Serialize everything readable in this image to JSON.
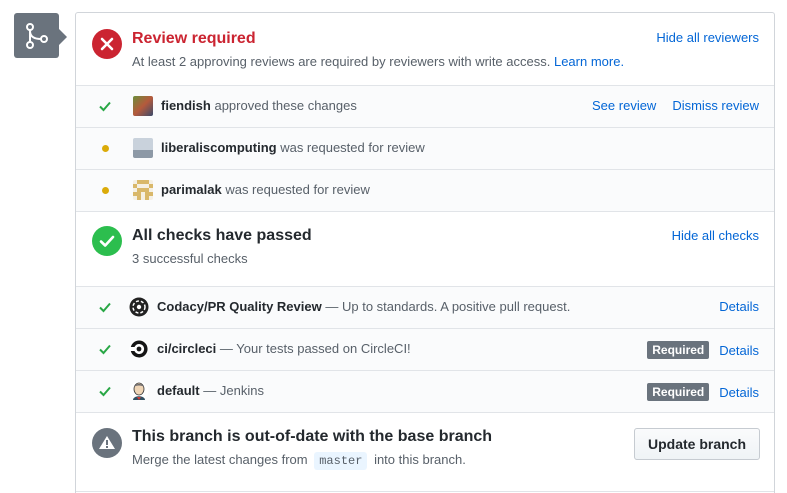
{
  "review": {
    "title": "Review required",
    "subtitle_text": "At least 2 approving reviews are required by reviewers with write access.",
    "learn_more": "Learn more.",
    "hide_link": "Hide all reviewers",
    "status_color": "#cb2431",
    "reviewers": [
      {
        "name": "fiendish",
        "action": "approved these changes",
        "state": "approved",
        "links": [
          "See review",
          "Dismiss review"
        ]
      },
      {
        "name": "liberaliscomputing",
        "action": "was requested for review",
        "state": "pending"
      },
      {
        "name": "parimalak",
        "action": "was requested for review",
        "state": "pending"
      }
    ]
  },
  "checks": {
    "title": "All checks have passed",
    "subtitle": "3 successful checks",
    "hide_link": "Hide all checks",
    "status_color": "#2cbe4e",
    "items": [
      {
        "name": "Codacy/PR Quality Review",
        "description": "— Up to standards. A positive pull request.",
        "required": false,
        "details": "Details"
      },
      {
        "name": "ci/circleci",
        "description": "— Your tests passed on CircleCI!",
        "required": true,
        "required_label": "Required",
        "details": "Details"
      },
      {
        "name": "default",
        "description": "— Jenkins",
        "required": true,
        "required_label": "Required",
        "details": "Details"
      }
    ]
  },
  "branch": {
    "title": "This branch is out-of-date with the base branch",
    "sub_prefix": "Merge the latest changes from",
    "base_branch": "master",
    "sub_suffix": "into this branch.",
    "button": "Update branch"
  }
}
